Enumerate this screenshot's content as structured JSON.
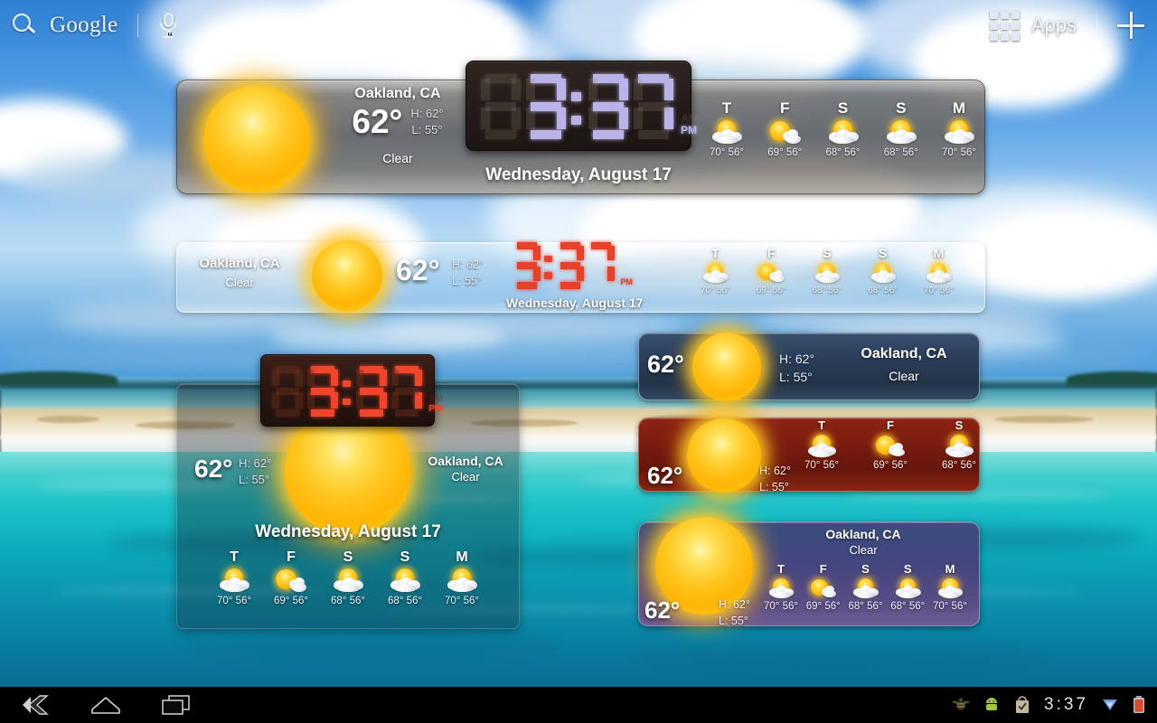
{
  "topbar": {
    "search_label": "Google",
    "search_icon": "search-icon",
    "mic_icon": "microphone-icon",
    "apps_label": "Apps",
    "apps_icon": "apps-grid-icon",
    "add_icon": "plus-icon"
  },
  "weather": {
    "city": "Oakland, CA",
    "temp": "62°",
    "high": "H: 62°",
    "low": "L: 55°",
    "condition": "Clear",
    "date": "Wednesday, August 17",
    "time": "3:37",
    "time_hour": "3",
    "time_minute": "37",
    "time_leading": "0",
    "am_label": "AM",
    "pm_label": "PM",
    "meridiem": "PM"
  },
  "forecast": [
    {
      "dow": "T",
      "icon": "sun-behind-clouds-icon",
      "hi": "70°",
      "lo": "56°",
      "temps": "70° 56°"
    },
    {
      "dow": "F",
      "icon": "sun-small-cloud-icon",
      "hi": "69°",
      "lo": "56°",
      "temps": "69° 56°"
    },
    {
      "dow": "S",
      "icon": "sun-behind-clouds-icon",
      "hi": "68°",
      "lo": "56°",
      "temps": "68° 56°"
    },
    {
      "dow": "S",
      "icon": "sun-behind-clouds-icon",
      "hi": "68°",
      "lo": "56°",
      "temps": "68° 56°"
    },
    {
      "dow": "M",
      "icon": "sun-behind-clouds-icon",
      "hi": "70°",
      "lo": "56°",
      "temps": "70° 56°"
    }
  ],
  "widgets": {
    "w1": {
      "name": "weather-clock-widget-large-gray"
    },
    "w2": {
      "name": "weather-clock-widget-glass-bar"
    },
    "w3": {
      "name": "weather-clock-widget-large-transparent"
    },
    "w4": {
      "name": "weather-widget-blue-compact"
    },
    "w5": {
      "name": "weather-widget-red-forecast"
    },
    "w6": {
      "name": "weather-widget-purple-forecast"
    }
  },
  "colors": {
    "clock_purple": "#b9b3e8",
    "clock_red": "#e8412a",
    "clock_red_deep": "#f0452b",
    "sun_core": "#ffc61f",
    "panel_gray": "#6e6a66",
    "panel_blue": "#2a3d58",
    "panel_red": "#7c1d10",
    "panel_purple": "#4b4780"
  },
  "systembar": {
    "back_icon": "back-arrow-icon",
    "home_icon": "home-icon",
    "recents_icon": "recent-apps-icon",
    "time": "3:37",
    "status_icons": [
      "bee-icon",
      "android-icon",
      "checklist-bag-icon",
      "wifi-icon",
      "battery-icon"
    ]
  }
}
